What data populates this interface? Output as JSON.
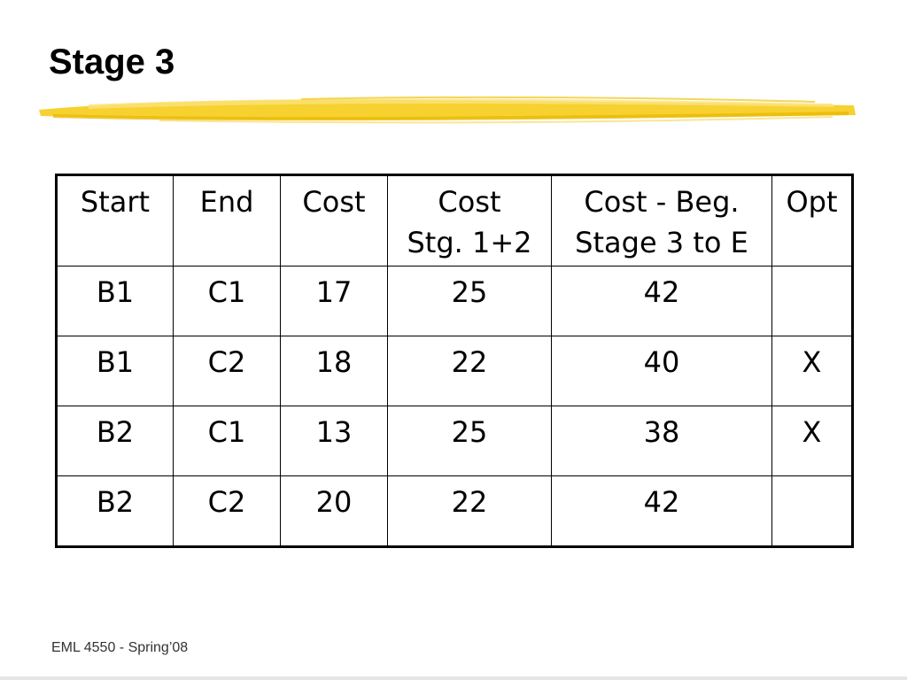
{
  "slide": {
    "title": "Stage 3",
    "footer": "EML 4550 - Spring’08",
    "accent_color": "#f2c200"
  },
  "table": {
    "headers": [
      [
        "Start"
      ],
      [
        "End"
      ],
      [
        "Cost"
      ],
      [
        "Cost",
        "Stg. 1+2"
      ],
      [
        "Cost - Beg.",
        "Stage 3 to E"
      ],
      [
        "Opt"
      ]
    ],
    "rows": [
      [
        "B1",
        "C1",
        "17",
        "25",
        "42",
        ""
      ],
      [
        "B1",
        "C2",
        "18",
        "22",
        "40",
        "X"
      ],
      [
        "B2",
        "C1",
        "13",
        "25",
        "38",
        "X"
      ],
      [
        "B2",
        "C2",
        "20",
        "22",
        "42",
        ""
      ]
    ]
  }
}
